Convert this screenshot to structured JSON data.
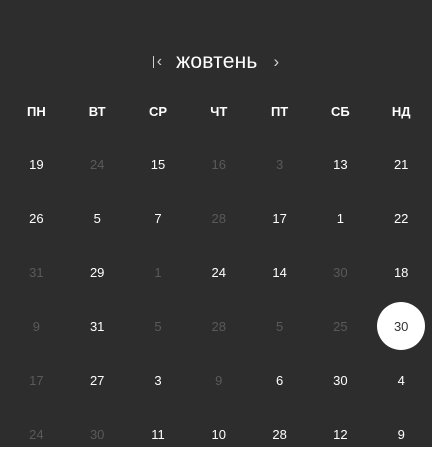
{
  "calendar": {
    "month": "жовтень",
    "prev_icon": "chevron-left-bar-icon",
    "next_icon": "chevron-right-icon",
    "weekdays": [
      "ПН",
      "ВТ",
      "СР",
      "ЧТ",
      "ПТ",
      "СБ",
      "НД"
    ],
    "weeks": [
      [
        {
          "d": "19",
          "m": false
        },
        {
          "d": "24",
          "m": true
        },
        {
          "d": "15",
          "m": false
        },
        {
          "d": "16",
          "m": true
        },
        {
          "d": "3",
          "m": true
        },
        {
          "d": "13",
          "m": false
        },
        {
          "d": "21",
          "m": false
        }
      ],
      [
        {
          "d": "26",
          "m": false
        },
        {
          "d": "5",
          "m": false
        },
        {
          "d": "7",
          "m": false
        },
        {
          "d": "28",
          "m": true
        },
        {
          "d": "17",
          "m": false
        },
        {
          "d": "1",
          "m": false
        },
        {
          "d": "22",
          "m": false
        }
      ],
      [
        {
          "d": "31",
          "m": true
        },
        {
          "d": "29",
          "m": false
        },
        {
          "d": "1",
          "m": true
        },
        {
          "d": "24",
          "m": false
        },
        {
          "d": "14",
          "m": false
        },
        {
          "d": "30",
          "m": true
        },
        {
          "d": "18",
          "m": false
        }
      ],
      [
        {
          "d": "9",
          "m": true
        },
        {
          "d": "31",
          "m": false
        },
        {
          "d": "5",
          "m": true
        },
        {
          "d": "28",
          "m": true
        },
        {
          "d": "5",
          "m": true
        },
        {
          "d": "25",
          "m": true
        },
        {
          "d": "30",
          "m": false,
          "selected": true
        }
      ],
      [
        {
          "d": "17",
          "m": true
        },
        {
          "d": "27",
          "m": false
        },
        {
          "d": "3",
          "m": false
        },
        {
          "d": "9",
          "m": true
        },
        {
          "d": "6",
          "m": false
        },
        {
          "d": "30",
          "m": false
        },
        {
          "d": "4",
          "m": false
        }
      ],
      [
        {
          "d": "24",
          "m": true
        },
        {
          "d": "30",
          "m": true
        },
        {
          "d": "11",
          "m": false
        },
        {
          "d": "10",
          "m": false
        },
        {
          "d": "28",
          "m": false
        },
        {
          "d": "12",
          "m": false
        },
        {
          "d": "9",
          "m": false
        }
      ]
    ]
  }
}
